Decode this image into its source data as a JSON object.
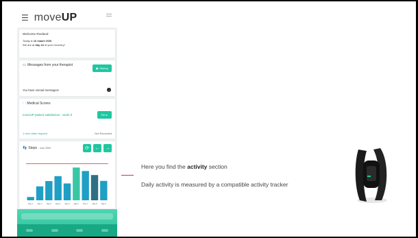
{
  "app": {
    "logo_prefix": "move",
    "logo_suffix": "UP",
    "menu_icon": "hamburger-icon"
  },
  "welcome": {
    "title": "Welcome Roeland",
    "today_prefix": "Today is ",
    "today_date": "16 maart 2020",
    "today_suffix": ".",
    "day_prefix": "We are at ",
    "day_value": "day 44",
    "day_suffix": " of your recovery!"
  },
  "messages": {
    "title": "Messages from your therapist",
    "history_button": "History",
    "unread_text": "You have unread messages!",
    "unread_badge": "!"
  },
  "medical_scores": {
    "title": "Medical Scores",
    "survey_link": "moveUP patient satisfaction - week 6",
    "fill_button": "Fill in",
    "video_request": "1 new video request",
    "status": "Not Recorded"
  },
  "steps": {
    "title": "Steps",
    "max_label": "- max 2000",
    "icons": [
      "refresh-icon",
      "arrow-left-icon",
      "arrow-right-icon"
    ]
  },
  "chart_data": {
    "type": "bar",
    "title": "Steps",
    "categories": [
      "Day 1",
      "Day 2",
      "Day 3",
      "Day 4",
      "Day 5",
      "Day 6",
      "Day 7",
      "Day 8",
      "Day 9"
    ],
    "values": [
      180,
      760,
      1050,
      1320,
      920,
      1790,
      1600,
      1380,
      1060
    ],
    "data_labels": [
      "",
      "",
      "",
      "",
      "",
      "",
      "",
      "",
      ""
    ],
    "target": 2000,
    "ylim": [
      0,
      2400
    ],
    "colors": {
      "bar": "#1f9fc4",
      "bar_highlight": "#39c6a4",
      "bar_dark": "#2f6f83",
      "target_line": "#d94848"
    }
  },
  "callout": {
    "line1_prefix": "Here you find the ",
    "line1_bold": "activity",
    "line1_suffix": " section",
    "line2": "Daily activity is measured by a compatible activity tracker"
  },
  "colors": {
    "accent": "#1fc7a0",
    "callout": "#d62f2f",
    "background": "#ffffff"
  }
}
